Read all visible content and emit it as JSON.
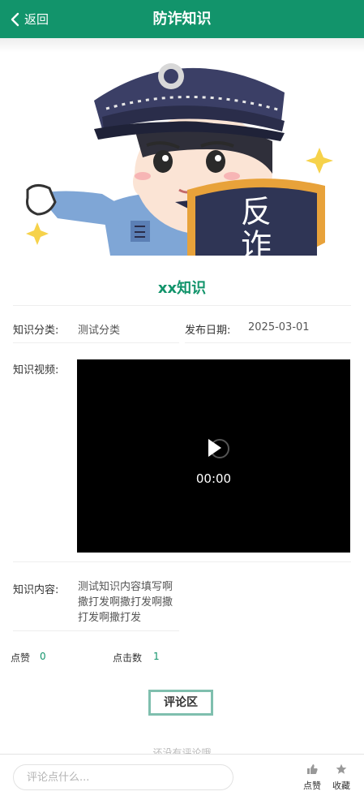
{
  "header": {
    "back_label": "返回",
    "title": "防诈知识",
    "bg_color": "#12946b"
  },
  "banner": {
    "badge_text": "反诈"
  },
  "knowledge": {
    "title": "xx知识",
    "category_label": "知识分类:",
    "category_value": "测试分类",
    "date_label": "发布日期:",
    "date_value": "2025-03-01",
    "video_label": "知识视频:",
    "video_time": "00:00",
    "content_label": "知识内容:",
    "content_value": "测试知识内容填写啊撒打发啊撒打发啊撒打发啊撒打发"
  },
  "stats": {
    "likes_label": "点赞",
    "likes_value": "0",
    "clicks_label": "点击数",
    "clicks_value": "1"
  },
  "comments": {
    "section_button": "评论区",
    "empty_text": "还没有评论哦"
  },
  "bottom_bar": {
    "input_placeholder": "评论点什么...",
    "like_label": "点赞",
    "favorite_label": "收藏"
  }
}
